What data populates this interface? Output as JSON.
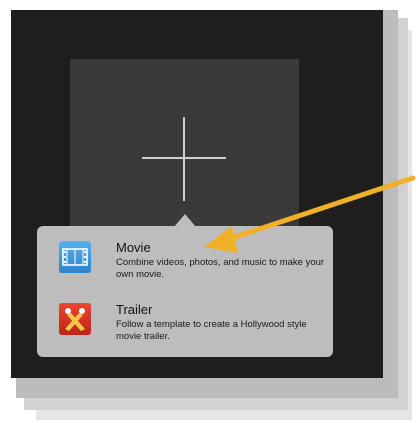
{
  "popover": {
    "items": [
      {
        "title": "Movie",
        "description": "Combine videos, photos, and music to make your own movie.",
        "icon": "film-strip-icon",
        "icon_color": "#3d96de"
      },
      {
        "title": "Trailer",
        "description": "Follow a template to create a Hollywood style movie trailer.",
        "icon": "spotlights-icon",
        "icon_color": "#d8321f"
      }
    ]
  },
  "new_project": {
    "icon": "plus-icon"
  },
  "annotation": {
    "arrow_color": "#f0b028"
  }
}
